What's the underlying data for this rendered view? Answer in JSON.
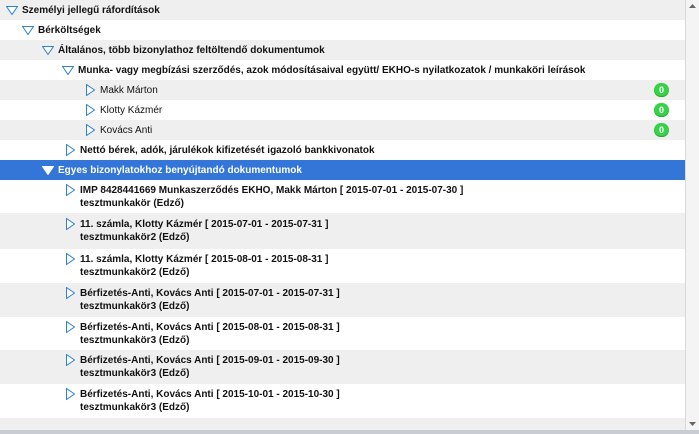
{
  "tree": {
    "root": {
      "label": "Személyi jellegű ráfordítások"
    },
    "berkoltsegek": {
      "label": "Bérköltségek"
    },
    "altalanos": {
      "label": "Általános, több bizonylathoz feltöltendő dokumentumok"
    },
    "munka": {
      "label": "Munka- vagy megbízási szerződés, azok módosításaival együtt/ EKHO-s nyilatkozatok / munkaköri leírások"
    },
    "people": [
      {
        "label": "Makk Márton",
        "count": "0"
      },
      {
        "label": "Klotty Kázmér",
        "count": "0"
      },
      {
        "label": "Kovács Anti",
        "count": "0"
      }
    ],
    "netto": {
      "label": "Nettó bérek, adók, járulékok kifizetését igazoló bankkivonatok"
    },
    "egyes": {
      "label": "Egyes bizonylatokhoz benyújtandó dokumentumok"
    },
    "docs": [
      {
        "line1": "IMP 8428441669 Munkaszerződés EKHO, Makk Márton [ 2015-07-01 - 2015-07-30 ]",
        "line2": "tesztmunkakör (Edző)"
      },
      {
        "line1": "11. számla, Klotty Kázmér [ 2015-07-01 - 2015-07-31 ]",
        "line2": "tesztmunkakör2 (Edző)"
      },
      {
        "line1": "11. számla, Klotty Kázmér [ 2015-08-01 - 2015-08-31 ]",
        "line2": "tesztmunkakör2 (Edző)"
      },
      {
        "line1": "Bérfizetés-Anti, Kovács Anti [ 2015-07-01 - 2015-07-31 ]",
        "line2": "tesztmunkakör3 (Edző)"
      },
      {
        "line1": "Bérfizetés-Anti, Kovács Anti [ 2015-08-01 - 2015-08-31 ]",
        "line2": "tesztmunkakör3 (Edző)"
      },
      {
        "line1": "Bérfizetés-Anti, Kovács Anti [ 2015-09-01 - 2015-09-30 ]",
        "line2": "tesztmunkakör3 (Edző)"
      },
      {
        "line1": "Bérfizetés-Anti, Kovács Anti [ 2015-10-01 - 2015-10-30 ]",
        "line2": "tesztmunkakör3 (Edző)"
      }
    ]
  },
  "colors": {
    "selected": "#3376d8",
    "badge": "#39d14a",
    "icon": "#2f7fd4"
  },
  "icons": {
    "expanded": "triangle-down-icon",
    "collapsed": "triangle-right-icon"
  }
}
